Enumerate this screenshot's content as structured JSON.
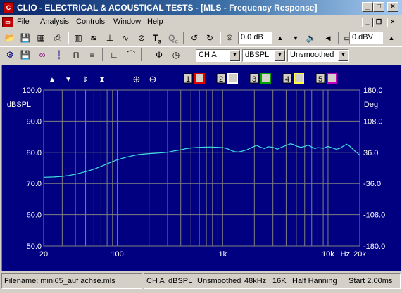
{
  "window": {
    "title": "CLIO - ELECTRICAL & ACOUSTICAL TESTS - [MLS - Frequency Response]"
  },
  "menu": [
    "File",
    "Analysis",
    "Controls",
    "Window",
    "Help"
  ],
  "toolbar": {
    "level_out": "0.0 dB",
    "level_in": "0 dBV",
    "channel": "CH A",
    "units": "dBSPL",
    "smoothing": "Unsmoothed"
  },
  "plot_toolbar": {
    "marker_slots": [
      "1",
      "2",
      "3",
      "4",
      "5"
    ]
  },
  "chart_data": {
    "type": "line",
    "title": "",
    "xlabel": "Hz",
    "x_scale": "log",
    "xlim": [
      20,
      20000
    ],
    "x_tick_labels": [
      "20",
      "100",
      "1k",
      "10k",
      "Hz",
      "20k"
    ],
    "ylabel": "dBSPL",
    "ylim": [
      50,
      100
    ],
    "y_tick_labels": [
      "100.0",
      "90.0",
      "80.0",
      "70.0",
      "60.0",
      "50.0"
    ],
    "y2label": "Deg",
    "y2lim": [
      -180,
      180
    ],
    "y2_tick_labels": [
      "180.0",
      "108.0",
      "36.0",
      "-36.0",
      "-108.0",
      "-180.0"
    ],
    "grid": true,
    "background_color": "#000080",
    "grid_color": "#808080",
    "series": [
      {
        "color": "#40e0e0",
        "points": [
          [
            20,
            72.0
          ],
          [
            25,
            72.1
          ],
          [
            30,
            72.3
          ],
          [
            35,
            72.6
          ],
          [
            40,
            73.0
          ],
          [
            45,
            73.4
          ],
          [
            50,
            73.8
          ],
          [
            60,
            74.6
          ],
          [
            70,
            75.5
          ],
          [
            80,
            76.3
          ],
          [
            90,
            77.0
          ],
          [
            100,
            77.6
          ],
          [
            120,
            78.4
          ],
          [
            140,
            78.9
          ],
          [
            160,
            79.3
          ],
          [
            200,
            79.6
          ],
          [
            250,
            79.8
          ],
          [
            300,
            80.0
          ],
          [
            350,
            80.5
          ],
          [
            400,
            80.8
          ],
          [
            450,
            81.2
          ],
          [
            500,
            81.4
          ],
          [
            600,
            81.6
          ],
          [
            700,
            81.7
          ],
          [
            800,
            81.7
          ],
          [
            900,
            81.6
          ],
          [
            1000,
            81.5
          ],
          [
            1100,
            81.2
          ],
          [
            1200,
            80.6
          ],
          [
            1300,
            80.2
          ],
          [
            1400,
            80.1
          ],
          [
            1500,
            80.3
          ],
          [
            1700,
            80.8
          ],
          [
            1900,
            81.6
          ],
          [
            2100,
            82.2
          ],
          [
            2300,
            81.6
          ],
          [
            2500,
            81.2
          ],
          [
            2700,
            81.8
          ],
          [
            3000,
            81.6
          ],
          [
            3300,
            81.0
          ],
          [
            3600,
            81.6
          ],
          [
            4000,
            82.2
          ],
          [
            4400,
            82.7
          ],
          [
            4700,
            82.5
          ],
          [
            5000,
            82.0
          ],
          [
            5500,
            81.6
          ],
          [
            6000,
            81.9
          ],
          [
            6500,
            82.3
          ],
          [
            7000,
            81.7
          ],
          [
            7500,
            81.2
          ],
          [
            8000,
            81.5
          ],
          [
            9000,
            81.3
          ],
          [
            10000,
            81.9
          ],
          [
            11000,
            81.4
          ],
          [
            12000,
            81.0
          ],
          [
            13000,
            81.3
          ],
          [
            14000,
            82.0
          ],
          [
            15000,
            82.6
          ],
          [
            16000,
            82.0
          ],
          [
            17000,
            81.2
          ],
          [
            18000,
            80.4
          ],
          [
            19000,
            79.8
          ],
          [
            20000,
            79.0
          ]
        ]
      }
    ]
  },
  "status": {
    "filename": "Filename: mini65_auf achse.mls",
    "items": [
      "CH A",
      "dBSPL",
      "Unsmoothed",
      "48kHz",
      "16K",
      "Half Hanning",
      "Start 2.00ms"
    ]
  }
}
